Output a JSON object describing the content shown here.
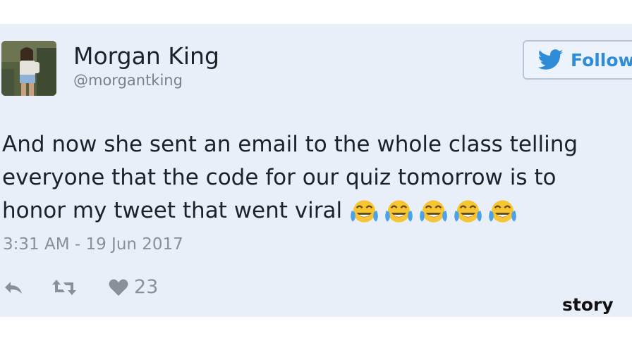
{
  "tweet": {
    "author_name": "Morgan King",
    "author_handle": "@morgantking",
    "follow_label": "Follow",
    "text_lines": [
      "And now she sent an email to the whole class telling",
      "everyone that the code for our quiz tomorrow is to",
      "honor my tweet that went viral"
    ],
    "emoji": [
      "face-with-tears-of-joy",
      "face-with-tears-of-joy",
      "face-with-tears-of-joy",
      "face-with-tears-of-joy",
      "face-with-tears-of-joy"
    ],
    "timestamp": "3:31 AM - 19 Jun 2017",
    "like_count": "23"
  },
  "icons": {
    "follow": "twitter-bird-icon",
    "reply": "reply-icon",
    "retweet": "retweet-icon",
    "like": "heart-icon"
  },
  "colors": {
    "card_background": "#e8eff9",
    "accent": "#2f8cd8",
    "muted_text": "#8a9097"
  },
  "watermark": "story"
}
